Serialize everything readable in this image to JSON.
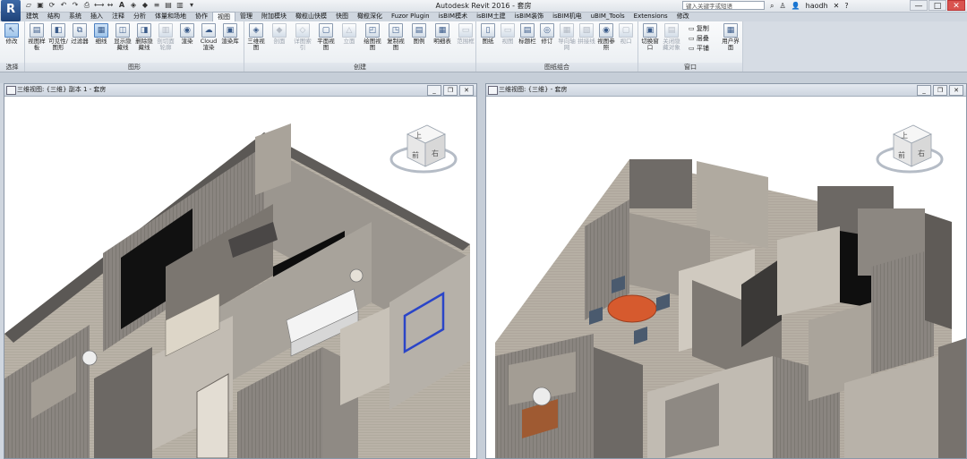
{
  "app": {
    "button_label": "R",
    "title": "Autodesk Revit 2016 -",
    "title_suffix": "套房",
    "search_placeholder": "键入关键字或短语",
    "user": "haodh",
    "help": "?"
  },
  "window_controls": [
    "—",
    "□",
    "✕"
  ],
  "tabs": [
    {
      "label": "建筑"
    },
    {
      "label": "结构"
    },
    {
      "label": "系统"
    },
    {
      "label": "插入"
    },
    {
      "label": "注释"
    },
    {
      "label": "分析"
    },
    {
      "label": "体量和场地"
    },
    {
      "label": "协作"
    },
    {
      "label": "视图",
      "active": true
    },
    {
      "label": "管理"
    },
    {
      "label": "附加模块"
    },
    {
      "label": "橄榄山快模"
    },
    {
      "label": "快图"
    },
    {
      "label": "橄榄深化"
    },
    {
      "label": "Fuzor Plugin"
    },
    {
      "label": "isBIM模术"
    },
    {
      "label": "isBIM土建"
    },
    {
      "label": "isBIM装饰"
    },
    {
      "label": "isBIM机电"
    },
    {
      "label": "uBIM_Tools"
    },
    {
      "label": "Extensions"
    },
    {
      "label": "修改"
    }
  ],
  "ribbon": {
    "select": {
      "button": "修改",
      "panel": "选择"
    },
    "graphics": {
      "panel": "图形",
      "buttons": [
        "视图样板",
        "可见性/图形",
        "过滤器",
        "细线",
        "显示隐藏线",
        "删除隐藏线",
        "剖切面轮廓",
        "渲染",
        "Cloud 渲染",
        "渲染库"
      ]
    },
    "create": {
      "panel": "创建",
      "buttons": [
        "三维视图",
        "剖面",
        "详图索引",
        "平面视图",
        "立面",
        "绘图视图",
        "复制视图",
        "图例",
        "明细表",
        "范围框"
      ]
    },
    "sheet": {
      "panel": "图纸组合",
      "buttons": [
        "图纸",
        "视图",
        "标题栏",
        "修订",
        "导向轴网",
        "拼接线",
        "视图参照",
        "视口"
      ]
    },
    "windows": {
      "panel": "窗口",
      "buttons": [
        "切换窗口",
        "关闭隐藏对象",
        "用户界面"
      ],
      "small": [
        "复制",
        "层叠",
        "平铺"
      ]
    }
  },
  "views": [
    {
      "title": "三维视图: {三维} 副本 1 - 套房"
    },
    {
      "title": "三维视图: {三维} - 套房"
    }
  ],
  "viewcube": {
    "top": "上",
    "front": "前",
    "right": "右"
  }
}
